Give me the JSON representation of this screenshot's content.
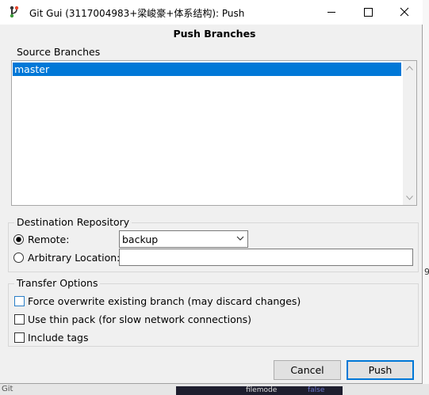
{
  "window": {
    "title": "Git Gui (3117004983+梁峻豪+体系结构): Push",
    "controls": [
      "minimize-icon",
      "maximize-icon",
      "close-icon"
    ]
  },
  "dialog": {
    "heading": "Push Branches"
  },
  "source_branches": {
    "legend": "Source Branches",
    "items": [
      {
        "label": "master",
        "selected": true
      }
    ]
  },
  "destination": {
    "legend": "Destination Repository",
    "remote_label": "Remote:",
    "remote_selected": true,
    "remote_value": "backup",
    "arbitrary_label": "Arbitrary Location:",
    "arbitrary_value": ""
  },
  "transfer": {
    "legend": "Transfer Options",
    "options": [
      {
        "label": "Force overwrite existing branch (may discard changes)",
        "checked": false
      },
      {
        "label": "Use thin pack (for slow network connections)",
        "checked": false
      },
      {
        "label": "Include tags",
        "checked": false
      }
    ]
  },
  "buttons": {
    "cancel": "Cancel",
    "push": "Push"
  },
  "background_fragments": {
    "right_digit": "9",
    "bottom_left": "Git",
    "bottom_code": "filemode",
    "bottom_code2": "false"
  },
  "colors": {
    "selection": "#0078d7",
    "default_button_border": "#0078d7"
  }
}
